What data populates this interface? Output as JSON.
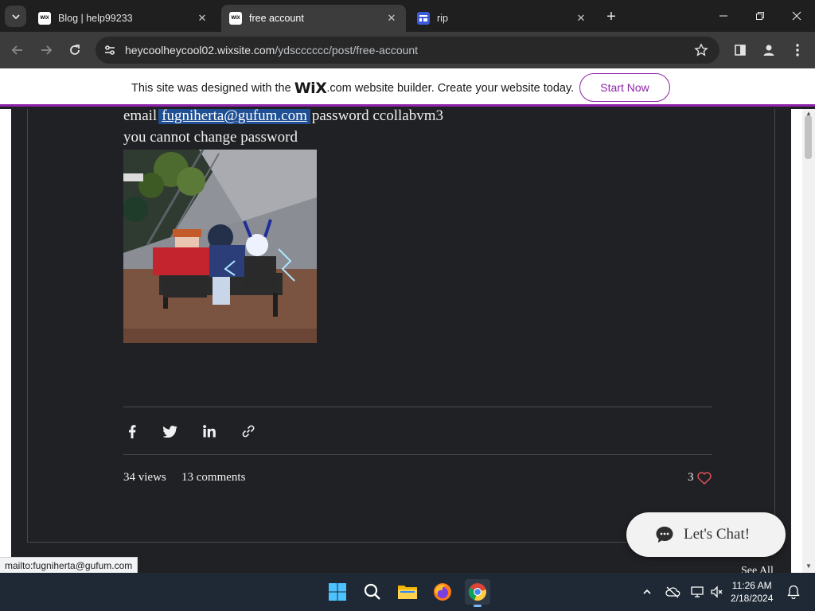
{
  "browser": {
    "tabs": [
      {
        "title": "Blog | help99233",
        "favicon": "wix-favicon",
        "active": false
      },
      {
        "title": "free account",
        "favicon": "wix-favicon",
        "active": true
      },
      {
        "title": "rip",
        "favicon": "form-favicon",
        "active": false
      }
    ],
    "favicon_wix_text": "WIX",
    "url_host": "heycoolheycool02.wixsite.com",
    "url_path": "/ydscccccc/post/free-account"
  },
  "wix_banner": {
    "text_before": "This site was designed with the",
    "logo": "WiX",
    "text_after": ".com website builder. Create your website today.",
    "button": "Start Now",
    "accent": "#8e24aa"
  },
  "post": {
    "email_prefix": "email",
    "email": "fugniherta@gufum.com",
    "password_text": "password ccollabvm3",
    "note": "you cannot change password",
    "image": "roblox-avatars-sitting-on-bench",
    "views": "34 views",
    "comments": "13 comments",
    "likes": "3",
    "see_all": "See All",
    "share_icons": [
      "facebook-icon",
      "twitter-icon",
      "linkedin-icon",
      "link-icon"
    ]
  },
  "chat": {
    "label": "Let's Chat!"
  },
  "status_bar": "mailto:fugniherta@gufum.com",
  "taskbar": {
    "apps": [
      "windows-start-icon",
      "search-icon",
      "file-explorer-icon",
      "firefox-icon",
      "chrome-icon"
    ],
    "time": "11:26 AM",
    "date": "2/18/2024"
  }
}
